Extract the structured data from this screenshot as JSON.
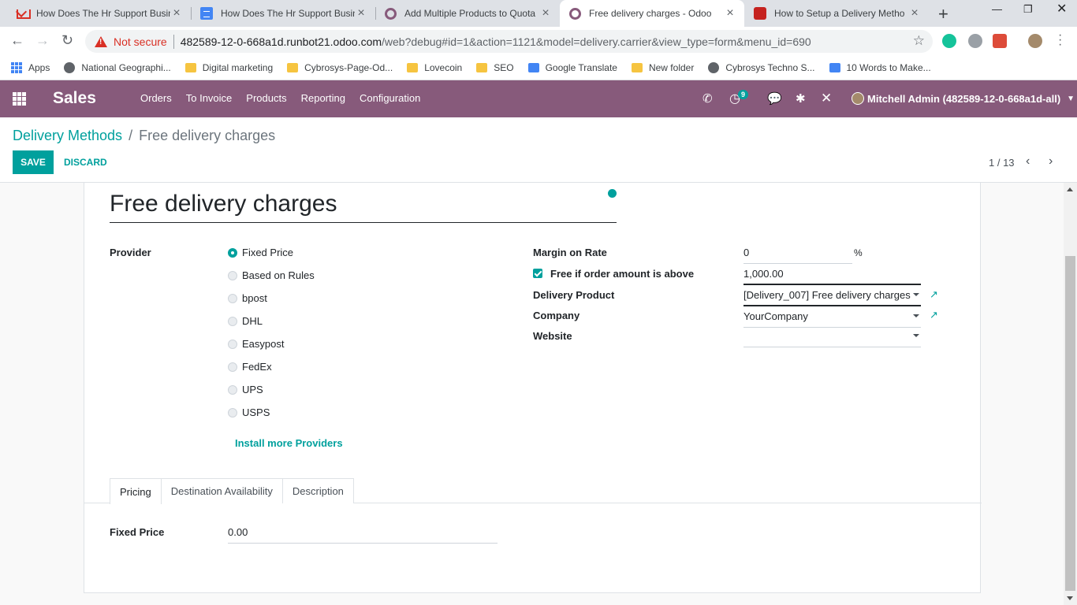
{
  "browser": {
    "tabs": [
      {
        "title": "How Does The Hr Support Busin",
        "icon": "gmail-icon"
      },
      {
        "title": "How Does The Hr Support Busin",
        "icon": "docs-icon"
      },
      {
        "title": "Add Multiple Products to Quota",
        "icon": "odoo-icon"
      },
      {
        "title": "Free delivery charges - Odoo",
        "icon": "odoo-icon"
      },
      {
        "title": "How to Setup a Delivery Metho",
        "icon": "red-icon"
      }
    ],
    "security_label": "Not secure",
    "url_host": "482589-12-0-668a1d.runbot21.odoo.com",
    "url_path": "/web?debug#id=1&action=1121&model=delivery.carrier&view_type=form&menu_id=690",
    "bookmarks": [
      "Apps",
      "National Geographi...",
      "Digital marketing",
      "Cybrosys-Page-Od...",
      "Lovecoin",
      "SEO",
      "Google Translate",
      "New folder",
      "Cybrosys Techno S...",
      "10 Words to Make..."
    ]
  },
  "navbar": {
    "brand": "Sales",
    "menu": [
      "Orders",
      "To Invoice",
      "Products",
      "Reporting",
      "Configuration"
    ],
    "activity_count": "9",
    "user": "Mitchell Admin (482589-12-0-668a1d-all)"
  },
  "control_panel": {
    "breadcrumb_parent": "Delivery Methods",
    "breadcrumb_sep": "/",
    "breadcrumb_current": "Free delivery charges",
    "save_label": "SAVE",
    "discard_label": "DISCARD",
    "pager": "1 / 13"
  },
  "form": {
    "title": "Free delivery charges",
    "provider_label": "Provider",
    "providers": [
      "Fixed Price",
      "Based on Rules",
      "bpost",
      "DHL",
      "Easypost",
      "FedEx",
      "UPS",
      "USPS"
    ],
    "selected_provider": "Fixed Price",
    "install_more": "Install more Providers",
    "margin_label": "Margin on Rate",
    "margin_value": "0",
    "margin_unit": "%",
    "free_label": "Free if order amount is above",
    "free_checked": true,
    "free_value": "1,000.00",
    "delivery_product_label": "Delivery Product",
    "delivery_product_value": "[Delivery_007] Free delivery charges",
    "company_label": "Company",
    "company_value": "YourCompany",
    "website_label": "Website",
    "website_value": "",
    "tabs": [
      "Pricing",
      "Destination Availability",
      "Description"
    ],
    "active_tab": "Pricing",
    "fixed_price_label": "Fixed Price",
    "fixed_price_value": "0.00"
  },
  "colors": {
    "odoo_purple": "#875a7b",
    "odoo_teal": "#00A09D"
  }
}
